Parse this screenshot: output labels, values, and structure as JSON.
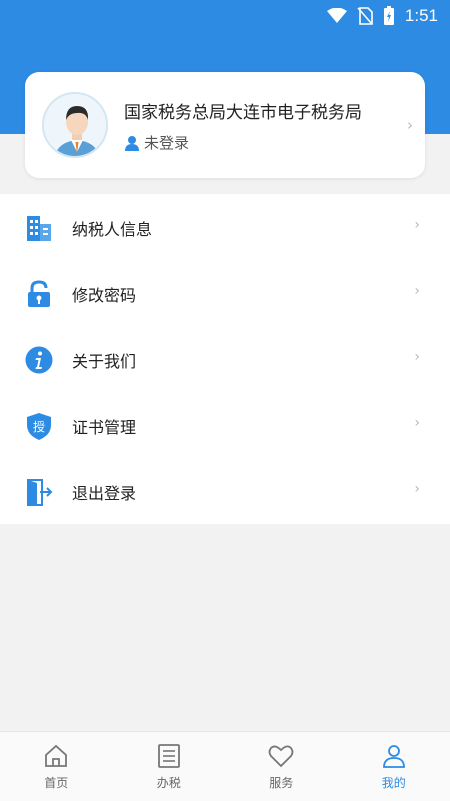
{
  "status_bar": {
    "time": "1:51"
  },
  "profile": {
    "org_name": "国家税务总局大连市电子税务局",
    "login_status": "未登录"
  },
  "menu": {
    "items": [
      {
        "label": "纳税人信息",
        "icon": "building-icon"
      },
      {
        "label": "修改密码",
        "icon": "lock-icon"
      },
      {
        "label": "关于我们",
        "icon": "info-icon"
      },
      {
        "label": "证书管理",
        "icon": "shield-auth-icon",
        "icon_text": "授"
      },
      {
        "label": "退出登录",
        "icon": "exit-door-icon"
      }
    ]
  },
  "bottom_nav": {
    "items": [
      {
        "label": "首页",
        "icon": "home-icon"
      },
      {
        "label": "办税",
        "icon": "list-icon"
      },
      {
        "label": "服务",
        "icon": "heart-icon"
      },
      {
        "label": "我的",
        "icon": "person-icon",
        "active": true
      }
    ]
  },
  "colors": {
    "accent": "#2d8be3",
    "background": "#f2f2f2"
  }
}
